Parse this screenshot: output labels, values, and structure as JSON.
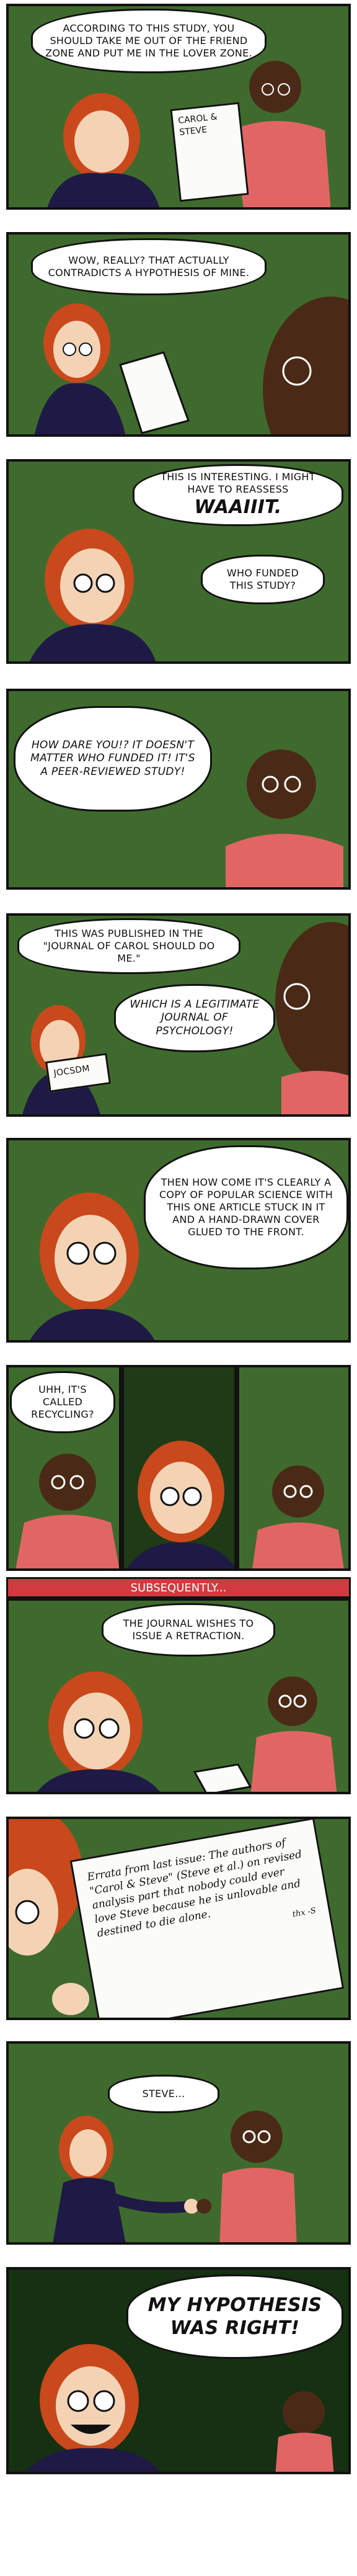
{
  "panels": [
    {
      "bubbles": [
        "ACCORDING TO THIS STUDY, YOU SHOULD TAKE ME OUT OF THE FRIEND ZONE AND PUT ME IN THE LOVER ZONE."
      ],
      "paper_title": "CAROL & STEVE"
    },
    {
      "bubbles": [
        "WOW, REALLY? THAT ACTUALLY CONTRADICTS A HYPOTHESIS OF MINE."
      ]
    },
    {
      "bubbles": [
        "THIS IS INTERESTING. I MIGHT HAVE TO REASSESS",
        "WAAIIIT.",
        "WHO FUNDED THIS STUDY?"
      ]
    },
    {
      "bubbles": [
        "HOW DARE YOU!? IT DOESN'T MATTER WHO FUNDED IT! IT'S A PEER-REVIEWED STUDY!"
      ]
    },
    {
      "bubbles": [
        "THIS WAS PUBLISHED IN THE \"JOURNAL OF CAROL SHOULD DO ME.\"",
        "WHICH IS A LEGITIMATE JOURNAL OF PSYCHOLOGY!"
      ],
      "paper_title": "JOCSDM"
    },
    {
      "bubbles": [
        "THEN HOW COME IT'S CLEARLY A COPY OF POPULAR SCIENCE WITH THIS ONE ARTICLE STUCK IN IT AND A HAND-DRAWN COVER GLUED TO THE FRONT."
      ]
    },
    {
      "bubbles": [
        "UHH, IT'S CALLED RECYCLING?"
      ]
    },
    {
      "caption": "SUBSEQUENTLY..."
    },
    {
      "bubbles": [
        "THE JOURNAL WISHES TO ISSUE A RETRACTION."
      ]
    },
    {
      "paper_text": "Errata from last issue: The authors of \"Carol & Steve\" (Steve et al.) on revised analysis part that nobody could ever love Steve because he is unlovable and destined to die alone.",
      "paper_footer": "thx -S"
    },
    {
      "bubbles": [
        "STEVE..."
      ]
    },
    {
      "bubbles": [
        "MY HYPOTHESIS WAS RIGHT!"
      ]
    }
  ],
  "colors": {
    "background": "#3f6a2d",
    "skin_carol": "#f4d3b5",
    "hair_carol": "#c9491c",
    "shirt_carol": "#1e1a45",
    "skin_steve": "#4a2a17",
    "shirt_steve": "#e26565",
    "caption": "#d13b3f"
  }
}
